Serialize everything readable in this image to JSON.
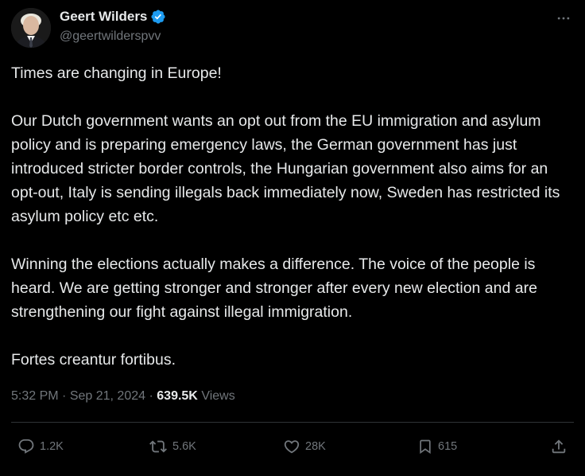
{
  "author": {
    "display_name": "Geert Wilders",
    "handle": "@geertwilderspvv",
    "verified": true
  },
  "tweet": {
    "paragraphs": [
      "Times are changing in Europe!",
      "Our Dutch government wants an opt out from the EU immigration and asylum policy and is preparing emergency laws, the German government has just introduced stricter border controls, the Hungarian government also aims for an opt-out, Italy is sending illegals back immediately now, Sweden has restricted its asylum policy etc etc.",
      "Winning the elections actually makes a difference. The voice of the people is heard. We are getting stronger and stronger after every new election and are strengthening our fight against illegal immigration.",
      "Fortes creantur fortibus."
    ],
    "time": "5:32 PM",
    "separator": "·",
    "date": "Sep 21, 2024",
    "views_count": "639.5K",
    "views_label": "Views"
  },
  "actions": {
    "reply": {
      "count": "1.2K",
      "icon": "reply-icon"
    },
    "repost": {
      "count": "5.6K",
      "icon": "repost-icon"
    },
    "like": {
      "count": "28K",
      "icon": "heart-icon"
    },
    "bookmark": {
      "count": "615",
      "icon": "bookmark-icon"
    },
    "share": {
      "icon": "share-icon"
    }
  },
  "colors": {
    "background": "#000000",
    "text": "#e7e9ea",
    "secondary": "#71767b",
    "verified": "#1d9bf0",
    "divider": "#2f3336"
  }
}
